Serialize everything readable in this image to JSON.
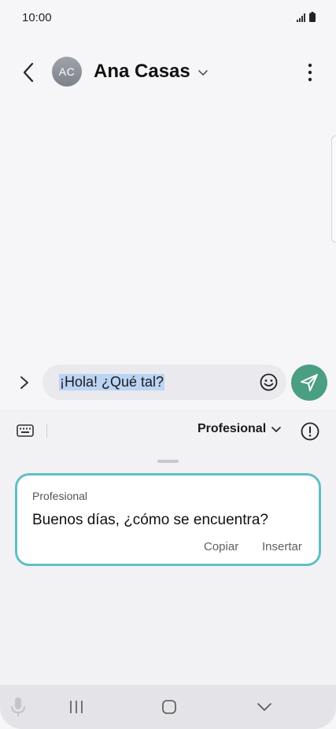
{
  "status_bar": {
    "time": "10:00"
  },
  "header": {
    "avatar_initials": "AC",
    "contact_name": "Ana Casas"
  },
  "composer": {
    "input_text": "¡Hola! ¿Qué tal?"
  },
  "writing_assist": {
    "tone_label": "Profesional",
    "suggestion": {
      "label": "Profesional",
      "text": "Buenos días, ¿cómo se encuentra?",
      "copy_label": "Copiar",
      "insert_label": "Insertar"
    }
  },
  "colors": {
    "send_button": "#4a9e82",
    "card_border": "#60bfc4",
    "text_selection": "#bcd4f4"
  },
  "icons": [
    "back-icon",
    "chevron-down-icon",
    "more-vert-icon",
    "expand-icon",
    "emoji-icon",
    "send-icon",
    "keyboard-icon",
    "info-icon",
    "mic-icon",
    "nav-recents-icon",
    "nav-home-icon",
    "nav-back-icon"
  ]
}
